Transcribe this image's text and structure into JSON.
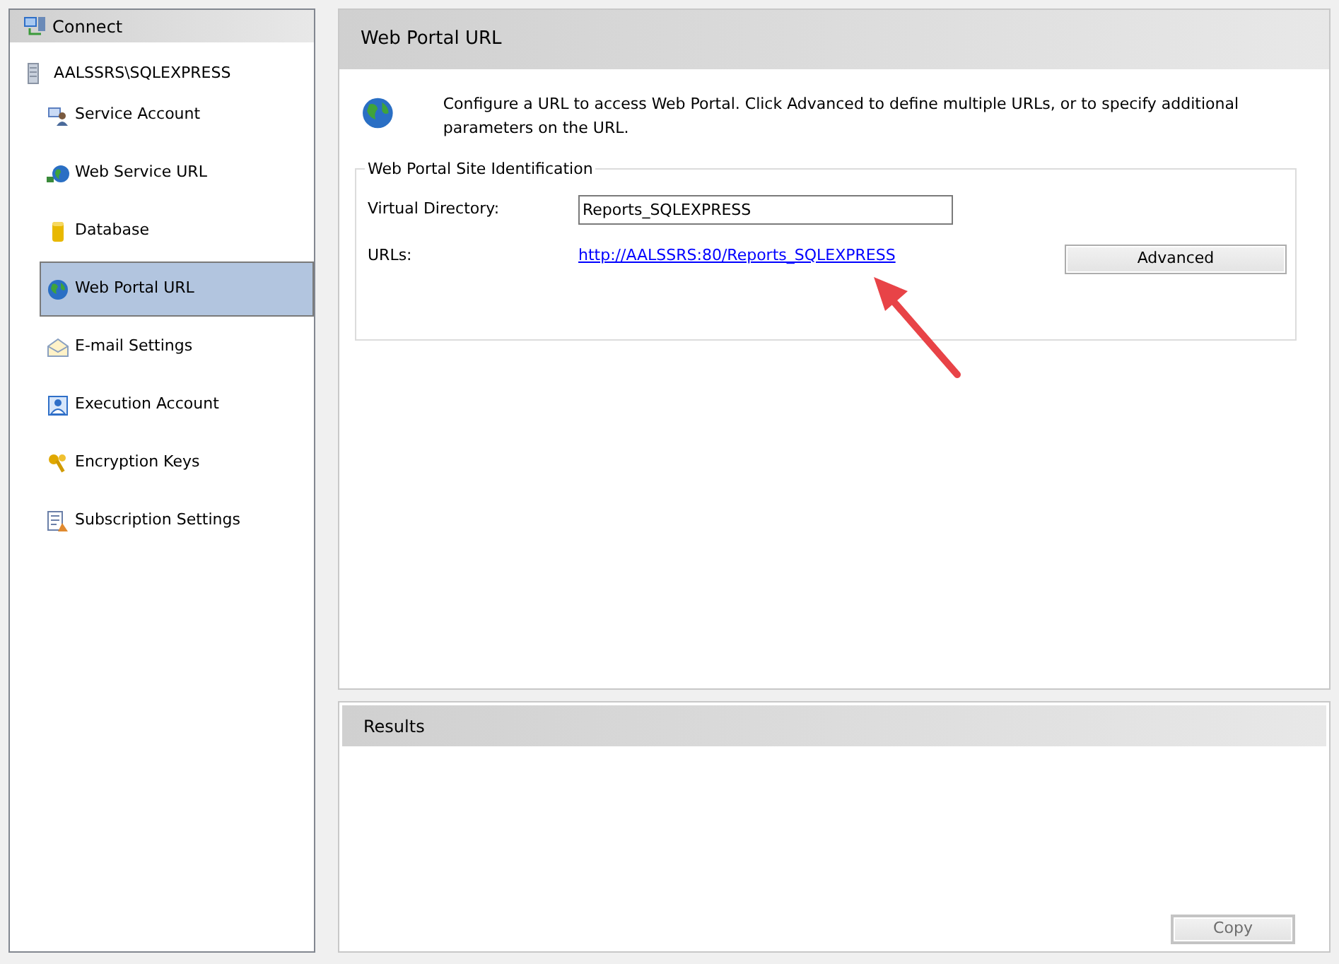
{
  "sidebar": {
    "header": "Connect",
    "server": "AALSSRS\\SQLEXPRESS",
    "items": [
      {
        "label": "Service Account",
        "selected": false
      },
      {
        "label": "Web Service URL",
        "selected": false
      },
      {
        "label": "Database",
        "selected": false
      },
      {
        "label": "Web Portal URL",
        "selected": true
      },
      {
        "label": "E-mail Settings",
        "selected": false
      },
      {
        "label": "Execution Account",
        "selected": false
      },
      {
        "label": "Encryption Keys",
        "selected": false
      },
      {
        "label": "Subscription Settings",
        "selected": false
      }
    ]
  },
  "main": {
    "title": "Web Portal URL",
    "description": "Configure a URL to access Web Portal.  Click Advanced to define multiple URLs, or to specify additional parameters on the URL.",
    "group": {
      "legend": "Web Portal Site Identification",
      "virtual_directory_label": "Virtual Directory:",
      "virtual_directory": "Reports_SQLEXPRESS",
      "urls_label": "URLs:",
      "url": "http://AALSSRS:80/Reports_SQLEXPRESS",
      "advanced_button": "Advanced"
    }
  },
  "results": {
    "title": "Results",
    "copy_button": {
      "label": "Copy",
      "disabled": true
    }
  }
}
